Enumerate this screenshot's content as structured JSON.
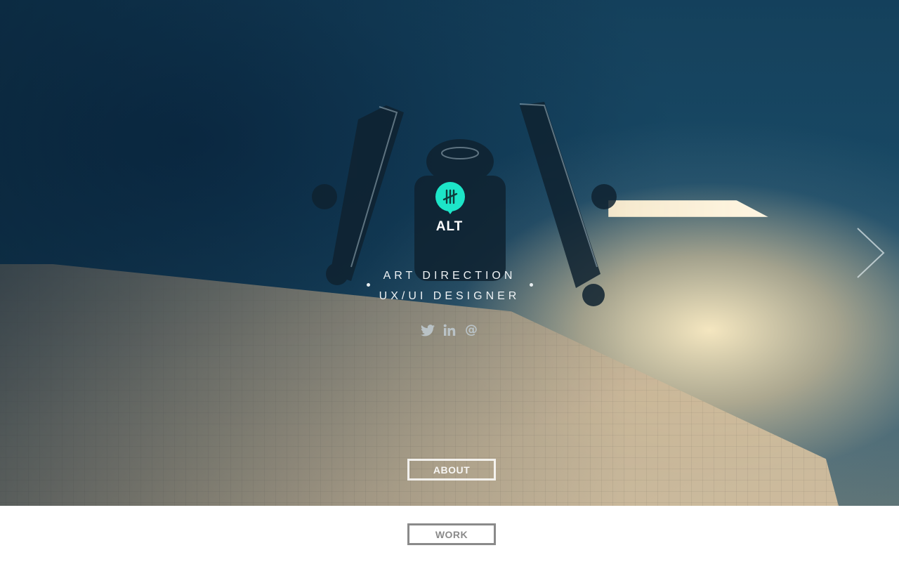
{
  "brand": {
    "name": "ALT",
    "logo_color": "#1de5c8"
  },
  "tagline": {
    "line1": "ART DIRECTION",
    "line2": "UX/UI DESIGNER"
  },
  "social": {
    "icons": [
      "twitter-icon",
      "linkedin-icon",
      "email-icon"
    ],
    "email_glyph": "@"
  },
  "navigation": {
    "about_label": "ABOUT",
    "work_label": "WORK",
    "next_icon": "chevron-right-icon"
  },
  "colors": {
    "accent": "#1de5c8",
    "work_button": "#8a8a8a",
    "page_background": "#ffffff"
  }
}
